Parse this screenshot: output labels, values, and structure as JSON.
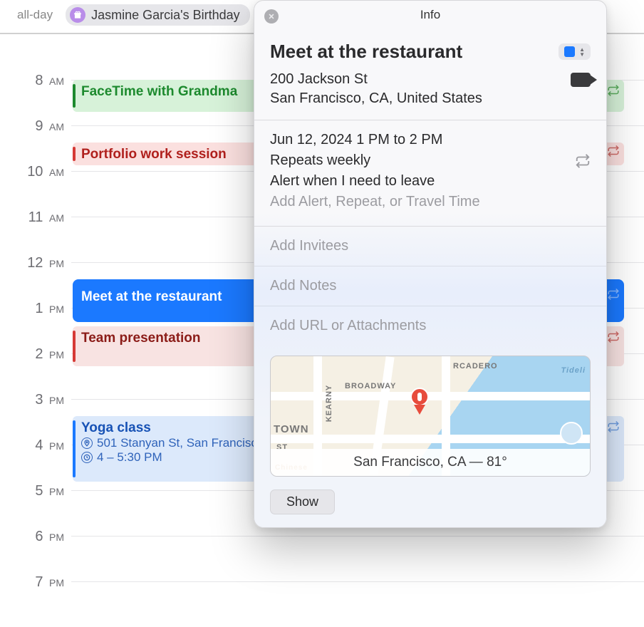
{
  "allday": {
    "label": "all-day",
    "birthday_label": "Jasmine Garcia's Birthday"
  },
  "hours": [
    {
      "num": "8",
      "suffix": "AM"
    },
    {
      "num": "9",
      "suffix": "AM"
    },
    {
      "num": "10",
      "suffix": "AM"
    },
    {
      "num": "11",
      "suffix": "AM"
    },
    {
      "num": "12",
      "suffix": "PM"
    },
    {
      "num": "1",
      "suffix": "PM"
    },
    {
      "num": "2",
      "suffix": "PM"
    },
    {
      "num": "3",
      "suffix": "PM"
    },
    {
      "num": "4",
      "suffix": "PM"
    },
    {
      "num": "5",
      "suffix": "PM"
    },
    {
      "num": "6",
      "suffix": "PM"
    },
    {
      "num": "7",
      "suffix": "PM"
    }
  ],
  "events": {
    "facetime": "FaceTime with Grandma",
    "portfolio": "Portfolio work session",
    "restaurant": "Meet at the restaurant",
    "team": "Team presentation",
    "yoga_title": "Yoga class",
    "yoga_loc": "501 Stanyan St, San Francisco",
    "yoga_time": "4 – 5:30 PM"
  },
  "popover": {
    "header": "Info",
    "title": "Meet at the restaurant",
    "address_line1": "200 Jackson St",
    "address_line2": "San Francisco, CA, United States",
    "datetime": "Jun 12, 2024  1 PM to 2 PM",
    "repeat": "Repeats weekly",
    "alert": "Alert when I need to leave",
    "add_art": "Add Alert, Repeat, or Travel Time",
    "invitees": "Add Invitees",
    "notes": "Add Notes",
    "url": "Add URL or Attachments",
    "map_location": "San Francisco, CA — 81°",
    "streets": {
      "broadway": "BROADWAY",
      "kearny": "KEARNY",
      "sacramento": "RCADERO",
      "town": "TOWN",
      "tide": "Tideli",
      "st": "ST",
      "chin": "Chinese"
    },
    "show": "Show"
  }
}
